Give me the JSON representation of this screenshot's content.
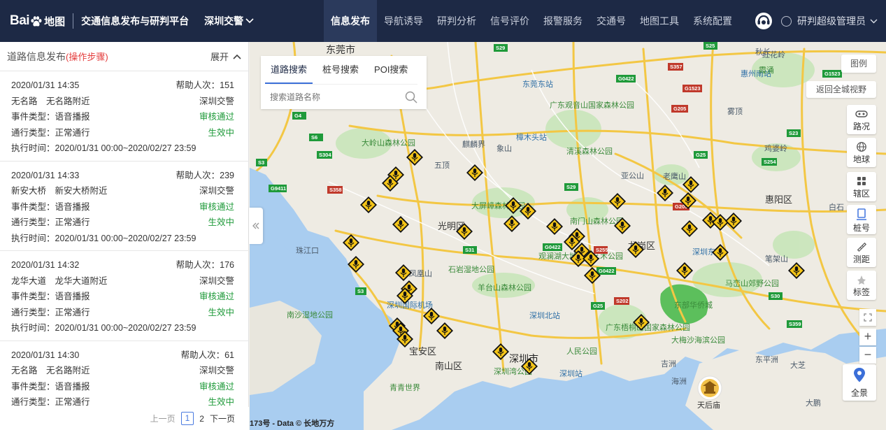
{
  "brand": {
    "logo_bai": "Bai",
    "logo_du": "du",
    "logo_map": "地图",
    "platform": "交通信息发布与研判平台",
    "city": "深圳交警"
  },
  "nav": [
    {
      "label": "信息发布",
      "active": true
    },
    {
      "label": "导航诱导"
    },
    {
      "label": "研判分析"
    },
    {
      "label": "信号评价"
    },
    {
      "label": "报警服务"
    },
    {
      "label": "交通号"
    },
    {
      "label": "地图工具"
    },
    {
      "label": "系统配置"
    }
  ],
  "user": {
    "name": "研判超级管理员"
  },
  "panel": {
    "title": "道路信息发布",
    "steps": "(操作步骤)",
    "expand": "展开"
  },
  "cards": [
    {
      "time": "2020/01/31 14:35",
      "help": "帮助人次：151",
      "road": "无名路　无名路附近",
      "org": "深圳交警",
      "event": "事件类型：语音播报",
      "review": "审核通过",
      "pass": "通行类型：正常通行",
      "status": "生效中",
      "exec": "执行时间：2020/01/31 00:00~2020/02/27 23:59"
    },
    {
      "time": "2020/01/31 14:33",
      "help": "帮助人次：239",
      "road": "新安大桥　新安大桥附近",
      "org": "深圳交警",
      "event": "事件类型：语音播报",
      "review": "审核通过",
      "pass": "通行类型：正常通行",
      "status": "生效中",
      "exec": "执行时间：2020/01/31 00:00~2020/02/27 23:59"
    },
    {
      "time": "2020/01/31 14:32",
      "help": "帮助人次：176",
      "road": "龙华大道　龙华大道附近",
      "org": "深圳交警",
      "event": "事件类型：语音播报",
      "review": "审核通过",
      "pass": "通行类型：正常通行",
      "status": "生效中",
      "exec": "执行时间：2020/01/31 00:00~2020/02/27 23:59"
    },
    {
      "time": "2020/01/31 14:30",
      "help": "帮助人次：61",
      "road": "无名路　无名路附近",
      "org": "深圳交警",
      "event": "事件类型：语音播报",
      "review": "审核通过",
      "pass": "通行类型：正常通行",
      "status": "生效中"
    }
  ],
  "pager": {
    "prev": "上一页",
    "page1": "1",
    "page2": "2",
    "next": "下一页"
  },
  "search": {
    "tabs": [
      "道路搜索",
      "桩号搜索",
      "POI搜索"
    ],
    "placeholder": "搜索道路名称"
  },
  "tools": {
    "legend": "图例",
    "return": "返回全城视野",
    "traffic": "路况",
    "earth": "地球",
    "district": "辖区",
    "stake": "桩号",
    "measure": "测距",
    "mark": "标签",
    "pano": "全景",
    "zoom_in": "+",
    "zoom_out": "−"
  },
  "copyright": "173号 - Data © 长地万方",
  "map_labels": [
    "东莞市",
    "东莞东站",
    "广东观音山国家森林公园",
    "樟木头站",
    "清溪森林公园",
    "麒麟界",
    "象山",
    "大岭山森林公园",
    "五顶",
    "大屏嶂森林公园",
    "光明区",
    "南门山森林公园",
    "龙岗区",
    "亚公山",
    "老鹰山",
    "惠阳区",
    "深圳东站",
    "马峦山郊野公园",
    "东部华侨城",
    "大梅沙海滨公园",
    "观澜湖大地生态艺术公园",
    "石岩湿地公园",
    "羊台山森林公园",
    "凤凰山",
    "深圳国际机场",
    "南沙湿地公园",
    "深圳北站",
    "广东梧桐山国家森林公园",
    "深圳市",
    "宝安区",
    "南山区",
    "深圳湾公园",
    "人民公园",
    "深圳站",
    "青青世界",
    "天后庙",
    "吉洲",
    "海洲",
    "惠州南站",
    "霞涌",
    "笔架山",
    "鸡婆岭",
    "雾顶",
    "白石",
    "大鹏",
    "红花岭",
    "秋长",
    "大芝",
    "九龙",
    "东平洲",
    "珠江口",
    "长安",
    "虎门",
    "凤岗",
    "清溪",
    "塘厦"
  ]
}
